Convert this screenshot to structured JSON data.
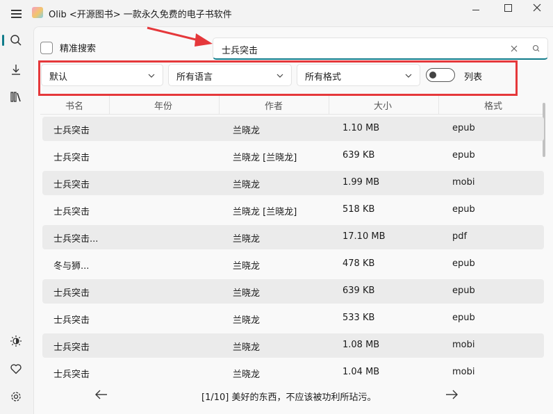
{
  "window": {
    "title": "Olib <开源图书> 一款永久免费的电子书软件"
  },
  "sidebar": {
    "top_items": [
      {
        "icon": "search-icon",
        "active": true
      },
      {
        "icon": "download-icon",
        "active": false
      },
      {
        "icon": "library-icon",
        "active": false
      }
    ],
    "bottom_items": [
      {
        "icon": "theme-icon"
      },
      {
        "icon": "heart-icon"
      },
      {
        "icon": "gear-icon"
      }
    ]
  },
  "search": {
    "exact_label": "精准搜索",
    "exact_checked": false,
    "value": "士兵突击"
  },
  "filters": {
    "sort": "默认",
    "language": "所有语言",
    "format": "所有格式",
    "list_toggle_label": "列表",
    "list_toggle_on": false
  },
  "table": {
    "columns": [
      "书名",
      "年份",
      "作者",
      "大小",
      "格式"
    ],
    "rows": [
      {
        "title": "士兵突击",
        "year": "",
        "author": "兰晓龙",
        "size": "1.10 MB",
        "format": "epub"
      },
      {
        "title": "士兵突击",
        "year": "",
        "author": "兰晓龙 [兰晓龙]",
        "size": "639 KB",
        "format": "epub"
      },
      {
        "title": "士兵突击",
        "year": "",
        "author": "兰晓龙",
        "size": "1.99 MB",
        "format": "mobi"
      },
      {
        "title": "士兵突击",
        "year": "",
        "author": "兰晓龙 [兰晓龙]",
        "size": "518 KB",
        "format": "epub"
      },
      {
        "title": "士兵突击...",
        "year": "",
        "author": "兰晓龙",
        "size": "17.10 MB",
        "format": "pdf"
      },
      {
        "title": "冬与狮...",
        "year": "",
        "author": "兰晓龙",
        "size": "478 KB",
        "format": "epub"
      },
      {
        "title": "士兵突击",
        "year": "",
        "author": "兰晓龙",
        "size": "639 KB",
        "format": "epub"
      },
      {
        "title": "士兵突击",
        "year": "",
        "author": "兰晓龙",
        "size": "533 KB",
        "format": "epub"
      },
      {
        "title": "士兵突击",
        "year": "",
        "author": "兰晓龙",
        "size": "1.08 MB",
        "format": "mobi"
      },
      {
        "title": "士兵突击",
        "year": "",
        "author": "兰晓龙",
        "size": "1.04 MB",
        "format": "mobi"
      }
    ]
  },
  "footer": {
    "quote": "[1/10] 美好的东西，不应该被功利所玷污。"
  },
  "colors": {
    "accent": "#0f7b8a",
    "annotation": "#e5383b"
  }
}
